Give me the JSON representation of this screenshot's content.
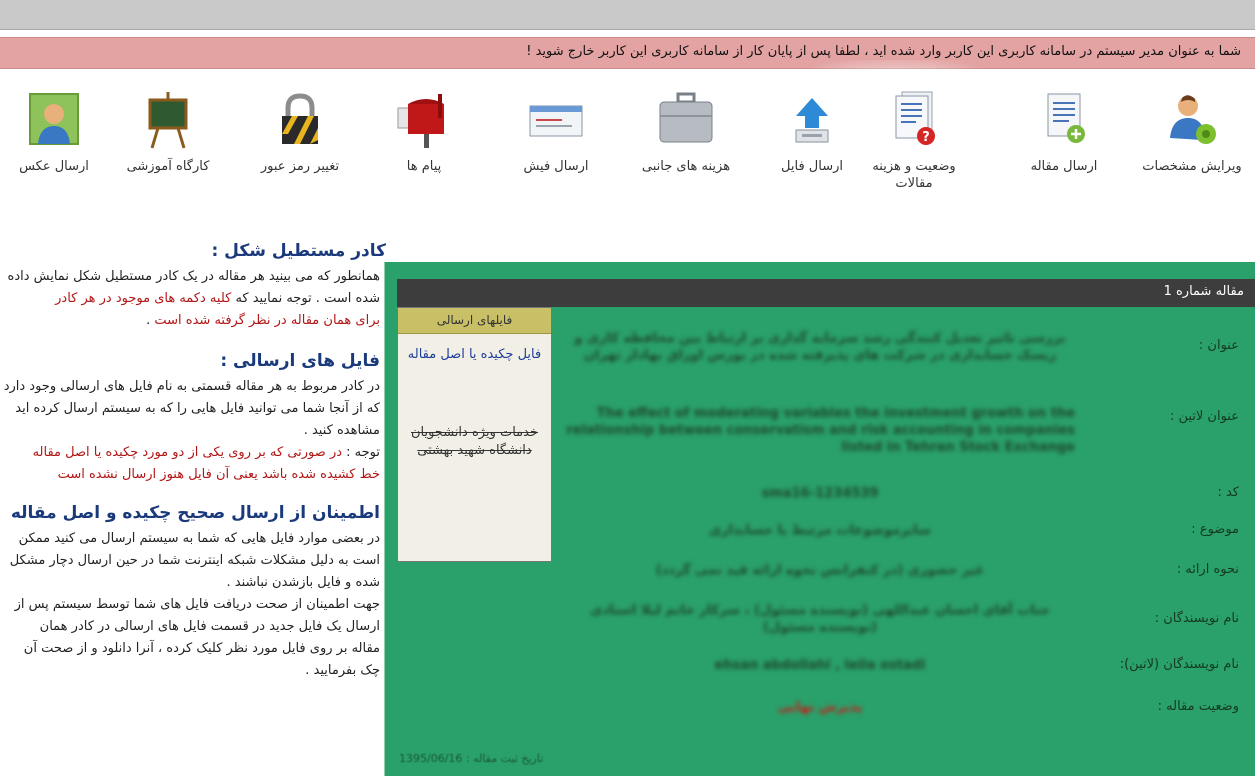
{
  "alert_text": "شما به عنوان مدیر سیستم در سامانه کاربری این کاربر وارد شده اید ، لطفا پس از پایان کار از سامانه کاربری این کاربر خارج شوید !",
  "toolbar": [
    {
      "name": "edit-profile",
      "icon": "user-gear-icon",
      "label": "ویرایش مشخصات"
    },
    {
      "name": "send-article",
      "icon": "document-add-icon",
      "label": "ارسال مقاله"
    },
    {
      "name": "article-status",
      "icon": "document-question-icon",
      "label": "وضعیت و هزینه مقالات"
    },
    {
      "name": "send-file",
      "icon": "upload-icon",
      "label": "ارسال فایل"
    },
    {
      "name": "extra-costs",
      "icon": "suitcase-icon",
      "label": "هزینه های جانبی"
    },
    {
      "name": "send-receipt",
      "icon": "receipt-icon",
      "label": "ارسال فیش"
    },
    {
      "name": "messages",
      "icon": "mailbox-icon",
      "label": "پیام ها"
    },
    {
      "name": "change-password",
      "icon": "lock-icon",
      "label": "تغییر رمز عبور"
    },
    {
      "name": "workshop",
      "icon": "easel-icon",
      "label": "کارگاه آموزشی"
    },
    {
      "name": "send-photo",
      "icon": "photo-icon",
      "label": "ارسال عکس"
    }
  ],
  "help": {
    "h1": "کادر مستطیل شکل :",
    "p1a": "همانطور که می بینید هر مقاله در یک کادر مستطیل شکل نمایش داده",
    "p1b": "شده است . توجه نمایید که ",
    "p1c": "کلیه دکمه های موجود در هر کادر",
    "p1d": "برای همان مقاله در نظر گرفته شده است",
    "p1e": " .",
    "h2": "فایل های ارسالی :",
    "p2a": "در کادر مربوط به هر مقاله قسمتی به نام فایل های ارسالی وجود دارد",
    "p2b": "که از آنجا شما می توانید فایل هایی را که به سیستم ارسال کرده اید",
    "p2c": "مشاهده کنید .",
    "p2d": "توجه : ",
    "p2e": "در صورتی که بر روی یکی از دو مورد چکیده یا اصل مقاله",
    "p2f": "خط کشیده شده باشد یعنی آن فایل هنوز ارسال نشده است",
    "h3": "اطمینان از ارسال صحیح چکیده و اصل مقاله",
    "p3a": "در بعضی موارد فایل هایی که شما به سیستم ارسال می کنید ممکن",
    "p3b": "است به دلیل مشکلات شبکه اینترنت شما در حین ارسال دچار مشکل",
    "p3c": "شده و فایل بازشدن نباشند .",
    "p3d": "جهت اطمینان از صحت دریافت فایل های شما توسط سیستم پس از",
    "p3e": "ارسال یک فایل جدید در قسمت فایل های ارسالی در کادر همان",
    "p3f": "مقاله بر روی فایل مورد نظر کلیک کرده ، آنرا دانلود و از صحت آن",
    "p3g": "چک بفرمایید ."
  },
  "card": {
    "header": "مقاله شماره 1",
    "files_title": "فایلهای ارسالی",
    "file_link": "فایل چکیده یا اصل مقاله",
    "file_struck": "خدمات ویژه دانشجویان دانشگاه شهید بهشتی",
    "rows": [
      {
        "key": "عنوان :",
        "value": "بررسی تاثیر تعدیل کنندگی رشد سرمایه گذاری بر ارتباط بین محافظه کاری و ریسک حسابداری در شرکت های پذیرفته شده در بورس اوراق بهادار تهران"
      },
      {
        "key": "عنوان لاتین :",
        "value": "The effect of moderating variables the investment growth on the relationship between conservatism and risk accounting in companies listed in Tehran Stock Exchange"
      },
      {
        "key": "کد :",
        "value": "sma16-1234539"
      },
      {
        "key": "موضوع :",
        "value": "سایرموضوعات مرتبط با حسابداری"
      },
      {
        "key": "نحوه ارائه :",
        "value": "غیر حضوری (در کنفرانس نحوه ارائه قید نمی گردد)"
      },
      {
        "key": "نام نویسندگان :",
        "value": "جناب آقای احسان عبداللهی (نویسنده مسئول) ، سرکار خانم لیلا استادی (نویسنده مسئول)"
      },
      {
        "key": "نام نویسندگان (لاتین):",
        "value": "ehsan abdollahi , leila ostadi"
      },
      {
        "key": "وضعیت مقاله :",
        "value": "پذیرش نهایی"
      }
    ],
    "footer": "تاریخ ثبت مقاله : 1395/06/16"
  }
}
